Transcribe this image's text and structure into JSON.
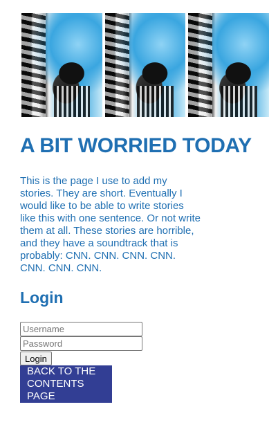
{
  "banner": {
    "tile_count": 3,
    "colors": {
      "sky": "#3aa6e0",
      "dark": "#111111",
      "light": "#f2f2f2"
    }
  },
  "header": {
    "title": "A BIT WORRIED TODAY"
  },
  "intro": {
    "text": "This is the page I use to add my stories. They are short. Eventually I would like to be able to write stories like this with one sentence. Or not write them at all. These stories are horrible, and they have a soundtrack that is probably: CNN. CNN. CNN. CNN. CNN. CNN. CNN."
  },
  "login": {
    "heading": "Login",
    "username_placeholder": "Username",
    "password_placeholder": "Password",
    "submit_label": "Login"
  },
  "nav": {
    "back_label": "BACK TO THE CONTENTS PAGE"
  },
  "colors": {
    "heading": "#1f6fb2",
    "back_button_bg": "#323e94",
    "back_button_text": "#ffffff"
  }
}
